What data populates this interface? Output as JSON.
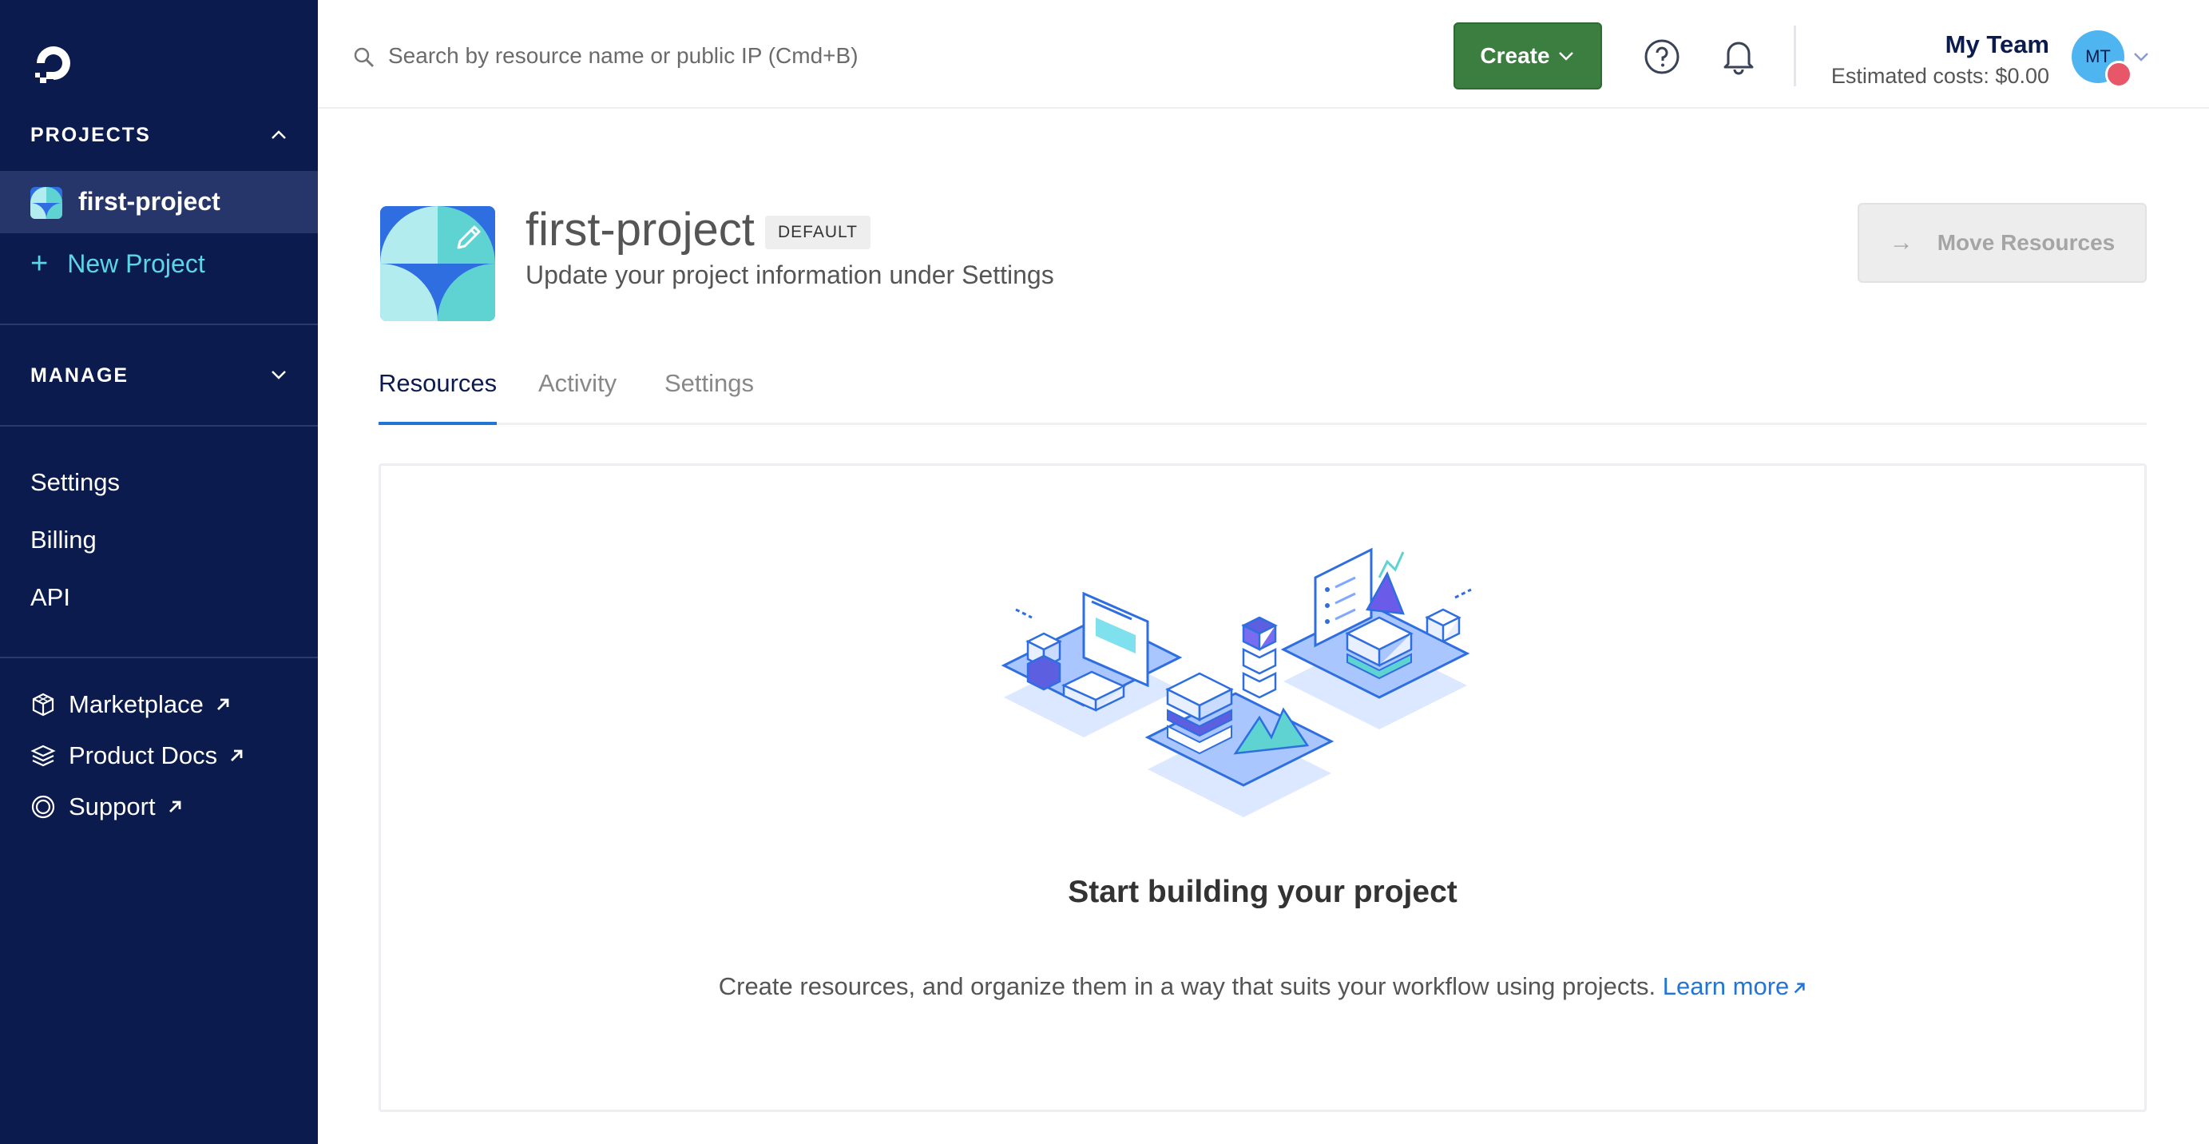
{
  "sidebar": {
    "projects_header": "PROJECTS",
    "active_project": "first-project",
    "new_project": "New Project",
    "manage_header": "MANAGE",
    "nav": [
      {
        "label": "Settings"
      },
      {
        "label": "Billing"
      },
      {
        "label": "API"
      }
    ],
    "external": [
      {
        "label": "Marketplace",
        "icon": "cube-icon"
      },
      {
        "label": "Product Docs",
        "icon": "layers-icon"
      },
      {
        "label": "Support",
        "icon": "lifebuoy-icon"
      }
    ]
  },
  "topbar": {
    "search_placeholder": "Search by resource name or public IP (Cmd+B)",
    "create_label": "Create",
    "team_name": "My Team",
    "estimated_costs": "Estimated costs: $0.00",
    "avatar_initials": "MT"
  },
  "project": {
    "title": "first-project",
    "badge": "DEFAULT",
    "subtitle": "Update your project information under Settings",
    "move_resources": "Move Resources"
  },
  "tabs": [
    {
      "label": "Resources",
      "active": true
    },
    {
      "label": "Activity",
      "active": false
    },
    {
      "label": "Settings",
      "active": false
    }
  ],
  "empty_state": {
    "title": "Start building your project",
    "description": "Create resources, and organize them in a way that suits your workflow using projects.",
    "learn_more": "Learn more"
  },
  "colors": {
    "sidebar_bg": "#0b1b4d",
    "create_green": "#3c7d40",
    "accent_blue": "#2474d6",
    "new_project_cyan": "#5cd6e6"
  }
}
